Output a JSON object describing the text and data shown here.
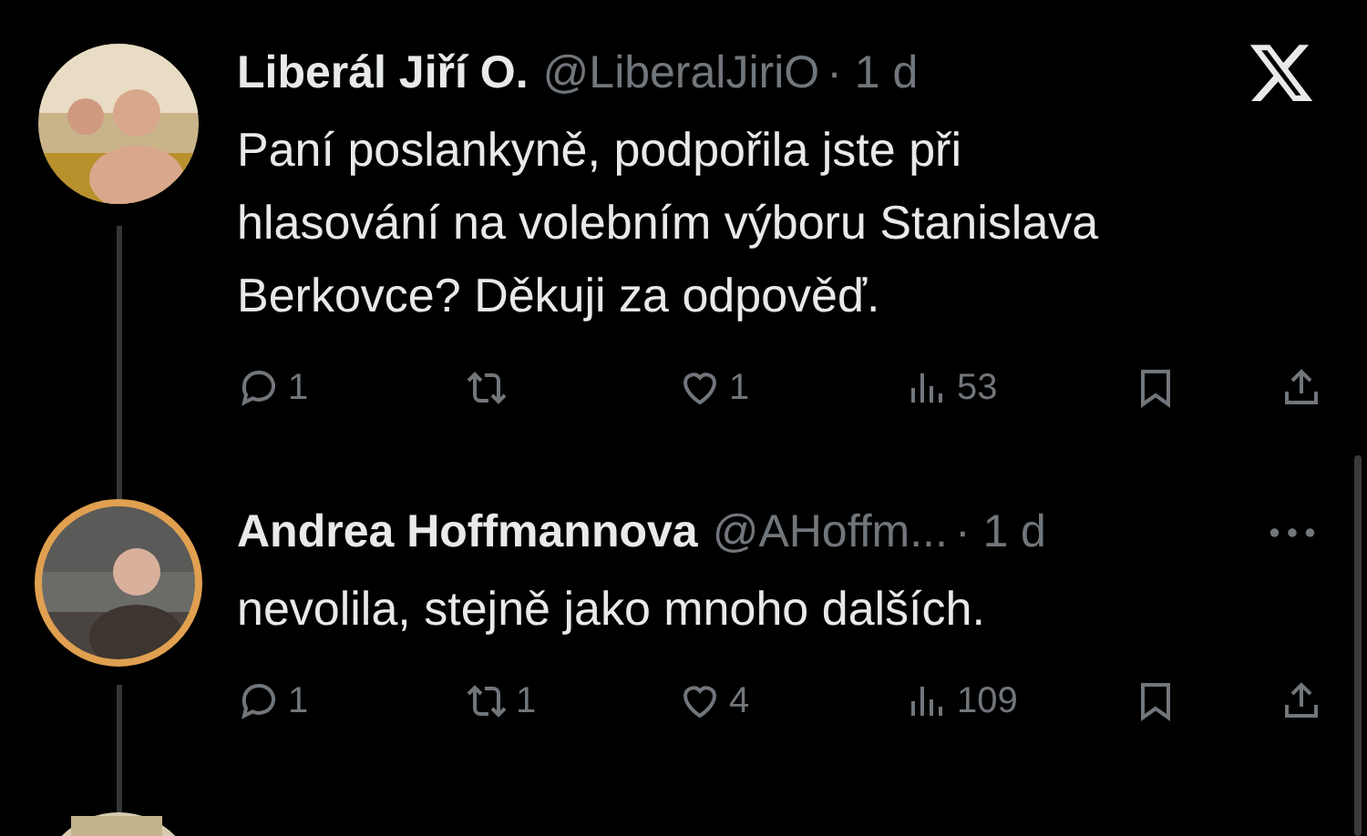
{
  "tweets": [
    {
      "name": "Liberál Jiří O.",
      "handle": "@LiberalJiriO",
      "time": "· 1 d",
      "kind": "logo",
      "thread_below": true,
      "text": [
        "Paní poslankyně, podpořila jste při",
        "hlasování na volebním výboru Stanislava",
        "Berkovce? Děkuji za odpověď."
      ],
      "replies": "1",
      "likes": "1",
      "views": "53"
    },
    {
      "name": "Andrea Hoffmannova",
      "handle": "@AHoffm...",
      "time": "· 1 d",
      "kind": "more",
      "thread_below": true,
      "text": [
        "nevolila, stejně jako mnoho dalších."
      ],
      "replies": "1",
      "reposts": "1",
      "likes": "4",
      "views": "109"
    }
  ]
}
